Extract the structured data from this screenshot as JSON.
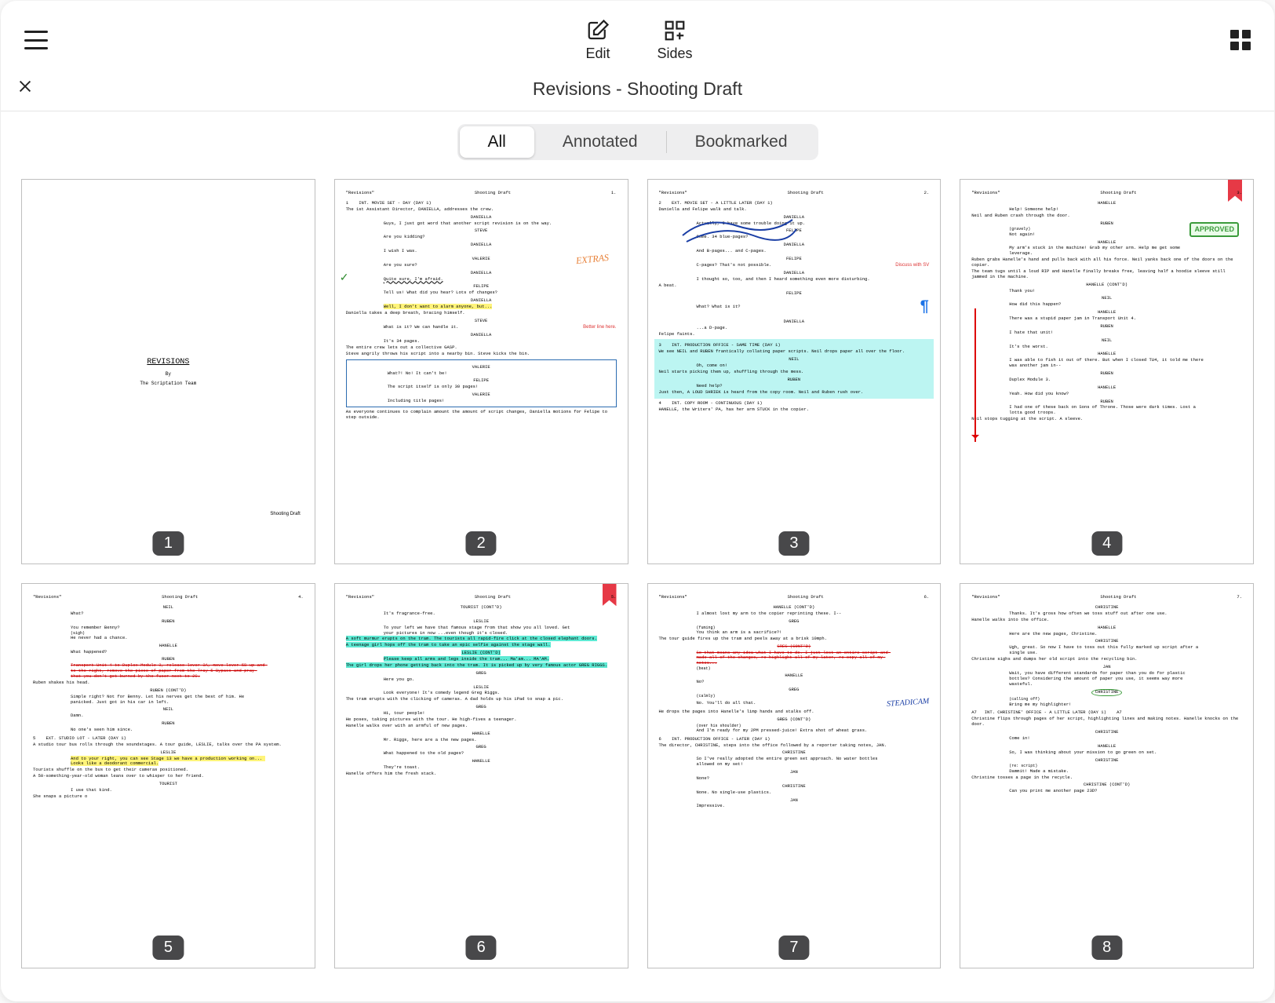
{
  "toolbar": {
    "edit_label": "Edit",
    "sides_label": "Sides"
  },
  "title": "Revisions - Shooting Draft",
  "tabs": {
    "all": "All",
    "annotated": "Annotated",
    "bookmarked": "Bookmarked"
  },
  "cover": {
    "title": "REVISIONS",
    "by": "By",
    "team": "The Scriptation Team",
    "footer": "Shooting Draft"
  },
  "page_header": {
    "title": "\"Revisions\"",
    "draft": "Shooting Draft"
  },
  "pages": [
    {
      "num": "1"
    },
    {
      "num": "2",
      "pg": "1.",
      "note_orange": "EXTRAS",
      "note_red": "Better line here.",
      "lines": {
        "scene": "1    INT. MOVIE SET - DAY (DAY 1)",
        "action1": "The 1st Assistant Director, DANIELLA, addresses the crew.",
        "c1": "DANIELLA",
        "d1": "Guys, I just got word that another script revision is on the way.",
        "c2": "STEVE",
        "d2": "Are you kidding?",
        "c3": "DANIELLA",
        "d3": "I wish I was.",
        "c4": "VALERIE",
        "d4": "Are you sure?",
        "c5": "DANIELLA",
        "d5": "Quite sure, I'm afraid.",
        "c6": "FELIPE",
        "d6": "Tell us! What did you hear? Lots of changes?",
        "c7": "DANIELLA",
        "d7": "Well, I don't want to alarm anyone, but...",
        "action2": "Daniella takes a deep breath, bracing himself.",
        "c8": "STEVE",
        "d8": "What is it? We can handle it.",
        "c9": "DANIELLA",
        "d9": "It's 34 pages.",
        "action3": "The entire crew lets out a collective GASP.",
        "action4": "Steve angrily throws his script into a nearby bin. Steve kicks the bin.",
        "c10": "VALERIE",
        "d10": "What?! No! It can't be!",
        "c11": "FELIPE",
        "d11": "The script itself is only 30 pages!",
        "c12": "VALERIE",
        "d12": "Including title pages!",
        "action5": "As everyone continues to complain amount the amount of script changes, Daniella motions for Felipe to step outside."
      }
    },
    {
      "num": "3",
      "pg": "2.",
      "note_red": "Discuss with SV",
      "lines": {
        "scene": "2    EXT. MOVIE SET - A LITTLE LATER (DAY 1)",
        "action1": "Daniella and Felipe walk and talk.",
        "c1": "DANIELLA",
        "d1": "Actually, I have some trouble doing it up.",
        "c2": "FELIPE",
        "d2": "Come. 34 blue-pages?",
        "c3": "DANIELLA",
        "d3": "And B-pages... and C-pages.",
        "c4": "FELIPE",
        "d4": "C-pages? That's not possible.",
        "c5": "DANIELLA",
        "d5": "I thought so, too, and then I heard something even more disturbing.",
        "action2": "A beat.",
        "c6": "FELIPE",
        "d6": "What? What is it?",
        "c7": "DANIELLA",
        "d7": "...a D-page.",
        "action3": "Felipe faints.",
        "scene2": "3    INT. PRODUCTION OFFICE - SAME TIME (DAY 1)",
        "a3a": "We see NEIL and RUBEN frantically collating paper scripts. Neil drops paper all over the floor.",
        "c8": "NEIL",
        "d8": "Oh, come on!",
        "a3b": "Neil starts picking them up, shuffling through the mess.",
        "c9": "RUBEN",
        "d9": "Need help?",
        "a3c": "Just then, A LOUD SHRIEK is heard from the copy room. Neil and Ruben rush over.",
        "scene3": "4    INT. COPY ROOM - CONTINUOUS (DAY 1)",
        "a4": "HANELLE, the Writers' PA, has her arm STUCK in the copier."
      }
    },
    {
      "num": "4",
      "pg": "3.",
      "bookmarked": true,
      "approved": "APPROVED",
      "lines": {
        "c1": "HANELLE",
        "d1": "Help! Someone help!",
        "a1": "Neil and Ruben crash through the door.",
        "c2": "RUBEN",
        "p2": "(gravely)",
        "d2": "Not again!",
        "c3": "HANELLE",
        "d3": "My arm's stuck in the machine! Grab my other arm. Help me get some leverage.",
        "a2": "Ruben grabs Hanelle's hand and pulls back with all his force. Neil yanks back one of the doors on the copier.",
        "a3": "The team tugs until a loud RIP and Hanelle finally breaks free, leaving half a hoodie sleeve still jammed in the machine.",
        "c4": "HANELLE (CONT'D)",
        "d4": "Thank you!",
        "c5": "NEIL",
        "d5": "How did this happen?",
        "c6": "HANELLE",
        "d6": "There was a stupid paper jam in Transport Unit 4.",
        "c7": "RUBEN",
        "d7": "I hate that unit!",
        "c8": "NEIL",
        "d8": "It's the worst.",
        "c9": "HANELLE",
        "d9": "I was able to fish it out of there. But when I closed TU4, it told me there was another jam in--",
        "c10": "RUBEN",
        "d10": "Duplex Module 3.",
        "c11": "HANELLE",
        "d11": "Yeah. How did you know?",
        "c12": "RUBEN",
        "d12": "I had one of these back on Sons of Throne. Those were dark times. Lost a lotta good troops.",
        "a4": "Neil stops tugging at the script. A sleeve."
      }
    },
    {
      "num": "5",
      "pg": "4.",
      "lines": {
        "c1": "NEIL",
        "d1": "What?",
        "c2": "RUBEN",
        "d2": "You remember Benny?",
        "p2": "(sigh)",
        "d2b": "He never had a chance.",
        "c3": "HANELLE",
        "d3": "What happened?",
        "c4": "RUBEN",
        "d4": "Transport Unit 4 to Duplex Module 3, release lever 3A, move lever 5B up and to the right, remove the piece of paper from the Tray 5 Bypass and pray that you don't get burned by the fuser next to 2C.",
        "a1": "Ruben shakes his head.",
        "c5": "RUBEN (CONT'D)",
        "d5": "Simple right? Not for Benny. Let his nerves get the best of him. He panicked. Just got in his car in left.",
        "c6": "NEIL",
        "d6": "Damn.",
        "c7": "RUBEN",
        "d7": "No one's seen him since.",
        "scene": "5    EXT. STUDIO LOT - LATER (DAY 1)",
        "a2": "A studio tour bus rolls through the soundstages. A tour guide, LESLIE, talks over the PA system.",
        "c8": "LESLIE",
        "d8": "And to your right, you can see Stage 13 we have a production working on... Looks like a deodorant commercial.",
        "a3": "Tourists shuffle on the bus to get their cameras positioned.",
        "a4": "A 50-something-year-old woman leans over to whisper to her friend.",
        "c9": "TOURIST",
        "d9": "I use that kind.",
        "a5": "She snaps a picture o"
      }
    },
    {
      "num": "6",
      "pg": "5.",
      "bookmarked": true,
      "lines": {
        "c1": "TOURIST (CONT'D)",
        "d1": "It's fragrance-free.",
        "c2": "LESLIE",
        "d2": "To your left we have that famous stage from that show you all loved. Get your pictures in now ...even though it's closed.",
        "a1": "A soft murmur erupts on the tram. The tourists all rapid-fire click at the closed elephant doors.",
        "a2": "A teenage girl hops off the tram to take an epic selfie against the stage wall.",
        "c3": "LESLIE (CONT'D)",
        "d3": "Please keep all arms and legs inside the tram... Ma'am... MA'AM.",
        "a3": "The girl drops her phone getting back into the tram. It is picked up by very famous actor GREG RIGGS.",
        "c4": "GREG",
        "d4": "Here you go.",
        "c5": "LESLIE",
        "d5": "Look everyone! It's comedy legend Greg Riggs.",
        "a4": "The tram erupts with the clicking of cameras. A dad holds up his iPad to snap a pic.",
        "c6": "GREG",
        "d6": "Hi, tour people!",
        "a5": "He poses, taking pictures with the tour. He high-fives a teenager.",
        "a6": "Hanelle walks over with an armful of new pages.",
        "c7": "HANELLE",
        "d7": "Mr. Riggs, here are a the new pages.",
        "c8": "GREG",
        "d8": "What happened to the old pages?",
        "c9": "HANELLE",
        "d9": "They're toast.",
        "a7": "Hanelle offers him the fresh stack."
      }
    },
    {
      "num": "7",
      "pg": "6.",
      "note_blue": "STEADICAM",
      "lines": {
        "c1": "HANELLE (CONT'D)",
        "d1": "I almost lost my arm to the copier reprinting these. I--",
        "c2": "GREG",
        "p2": "(fuming)",
        "d2": "You think an arm is a sacrifice?!",
        "a1": "The tour guide fires up the tram and peels away at a brisk 10mph.",
        "c3": "GREG (CONT'D)",
        "d3": "So that means any idea what I have to do. I just lost an entire script and made all of the changes, re-highlight all of my later, re-copy all of my notes...",
        "p3": "(beat)",
        "c4": "HANELLE",
        "d4": "No?",
        "c5": "GREG",
        "p5": "(calmly)",
        "d5": "No. You'll do all that.",
        "a2": "He drops the pages into Hanelle's limp hands and stalks off.",
        "c6": "GREG (CONT'D)",
        "p6": "(over his shoulder)",
        "d6": "And I'm ready for my 2PM pressed-juice! Extra shot of wheat grass.",
        "scene": "6    INT. PRODUCTION OFFICE - LATER (DAY 1)",
        "a3": "The director, CHRISTINE, steps into the office followed by a reporter taking notes, JAN.",
        "c7": "CHRISTINE",
        "d7": "So I've really adopted the entire green set approach. No water bottles allowed on my set!",
        "c8": "JAN",
        "d8": "None?",
        "c9": "CHRISTINE",
        "d9": "None. No single-use plastics.",
        "c10": "JAN",
        "d10": "Impressive."
      }
    },
    {
      "num": "8",
      "pg": "7.",
      "lines": {
        "c1": "CHRISTINE",
        "d1": "Thanks. It's gross how often we toss stuff out after one use.",
        "a1": "Hanelle walks into the office.",
        "c2": "HANELLE",
        "d2": "Here are the new pages, Christine.",
        "c3": "CHRISTINE",
        "d3": "Ugh, great. So now I have to toss out this fully marked up script after a single use.",
        "a2": "Christine sighs and dumps her old script into the recycling bin.",
        "c4": "JAN",
        "d4": "Wait, you have different standards for paper than you do for plastic bottles? Considering the amount of paper you use, it seems way more wasteful.",
        "c5": "CHRISTINE",
        "p5": "(calling off)",
        "d5": "Bring me my highlighter!",
        "scene": "A7   INT. CHRISTINE' OFFICE - A LITTLE LATER (DAY 1)    A7",
        "a3": "Christine flips through pages of her script, highlighting lines and making notes. Hanelle knocks on the door.",
        "c6": "CHRISTINE",
        "d6": "Come in!",
        "c7": "HANELLE",
        "d7": "So, I was thinking about your mission to go green on set.",
        "c8": "CHRISTINE",
        "p8": "(re: script)",
        "d8": "Dammit! Made a mistake.",
        "a4": "Christine tosses a page in the recycle.",
        "c9": "CHRISTINE (CONT'D)",
        "d9": "Can you print me another page 23D?"
      }
    }
  ]
}
